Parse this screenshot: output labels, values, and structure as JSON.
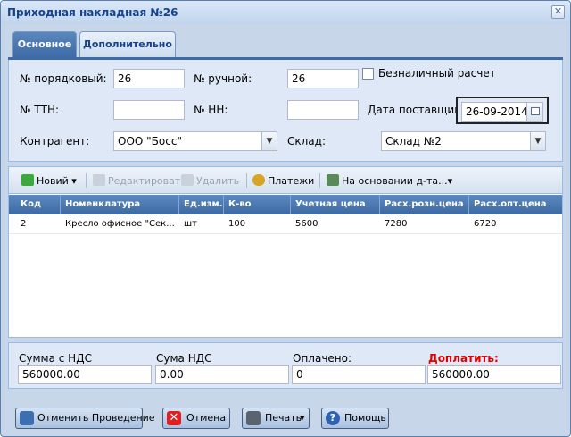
{
  "window": {
    "title": "Приходная накладная №26",
    "close_symbol": "✕"
  },
  "tabs": [
    {
      "label": "Основное",
      "active": true
    },
    {
      "label": "Дополнительно",
      "active": false
    }
  ],
  "form": {
    "seq_label": "№ порядковый:",
    "seq_value": "26",
    "manual_label": "№ ручной:",
    "manual_value": "26",
    "cashless_label": "Безналичный расчет",
    "cashless_checked": false,
    "ttn_label": "№ ТТН:",
    "ttn_value": "",
    "nn_label": "№ НН:",
    "nn_value": "",
    "supplier_date_label": "Дата поставщика:",
    "supplier_date_value": "26-09-2014",
    "contractor_label": "Контрагент:",
    "contractor_value": "ООО \"Босс\"",
    "warehouse_label": "Склад:",
    "warehouse_value": "Склад №2"
  },
  "toolbar": {
    "new_label": "Новий",
    "edit_label": "Редактировать",
    "delete_label": "Удалить",
    "payments_label": "Платежи",
    "based_on_label": "На основании д-та...",
    "dropdown_arrow": "▾"
  },
  "grid": {
    "columns": [
      "Код",
      "Номенклатура",
      "Ед.изм.",
      "К-во",
      "Учетная цена",
      "Расх.розн.цена",
      "Расх.опт.цена"
    ],
    "rows": [
      [
        "2",
        "Кресло офисное \"Сек...",
        "шт",
        "100",
        "5600",
        "7280",
        "6720"
      ]
    ]
  },
  "totals": {
    "with_vat_label": "Сумма с НДС",
    "with_vat_value": "560000.00",
    "vat_label": "Сума НДС",
    "vat_value": "0.00",
    "paid_label": "Оплачено:",
    "paid_value": "0",
    "due_label": "Доплатить:",
    "due_value": "560000.00",
    "due_color": "#e00000"
  },
  "buttons": {
    "unpost_label": "Отменить Проведение",
    "cancel_label": "Отмена",
    "print_label": "Печать",
    "help_label": "Помощь"
  },
  "colors": {
    "accent": "#3e6aa5",
    "panel": "#dfe8f6",
    "frame": "#c7d7e9"
  }
}
